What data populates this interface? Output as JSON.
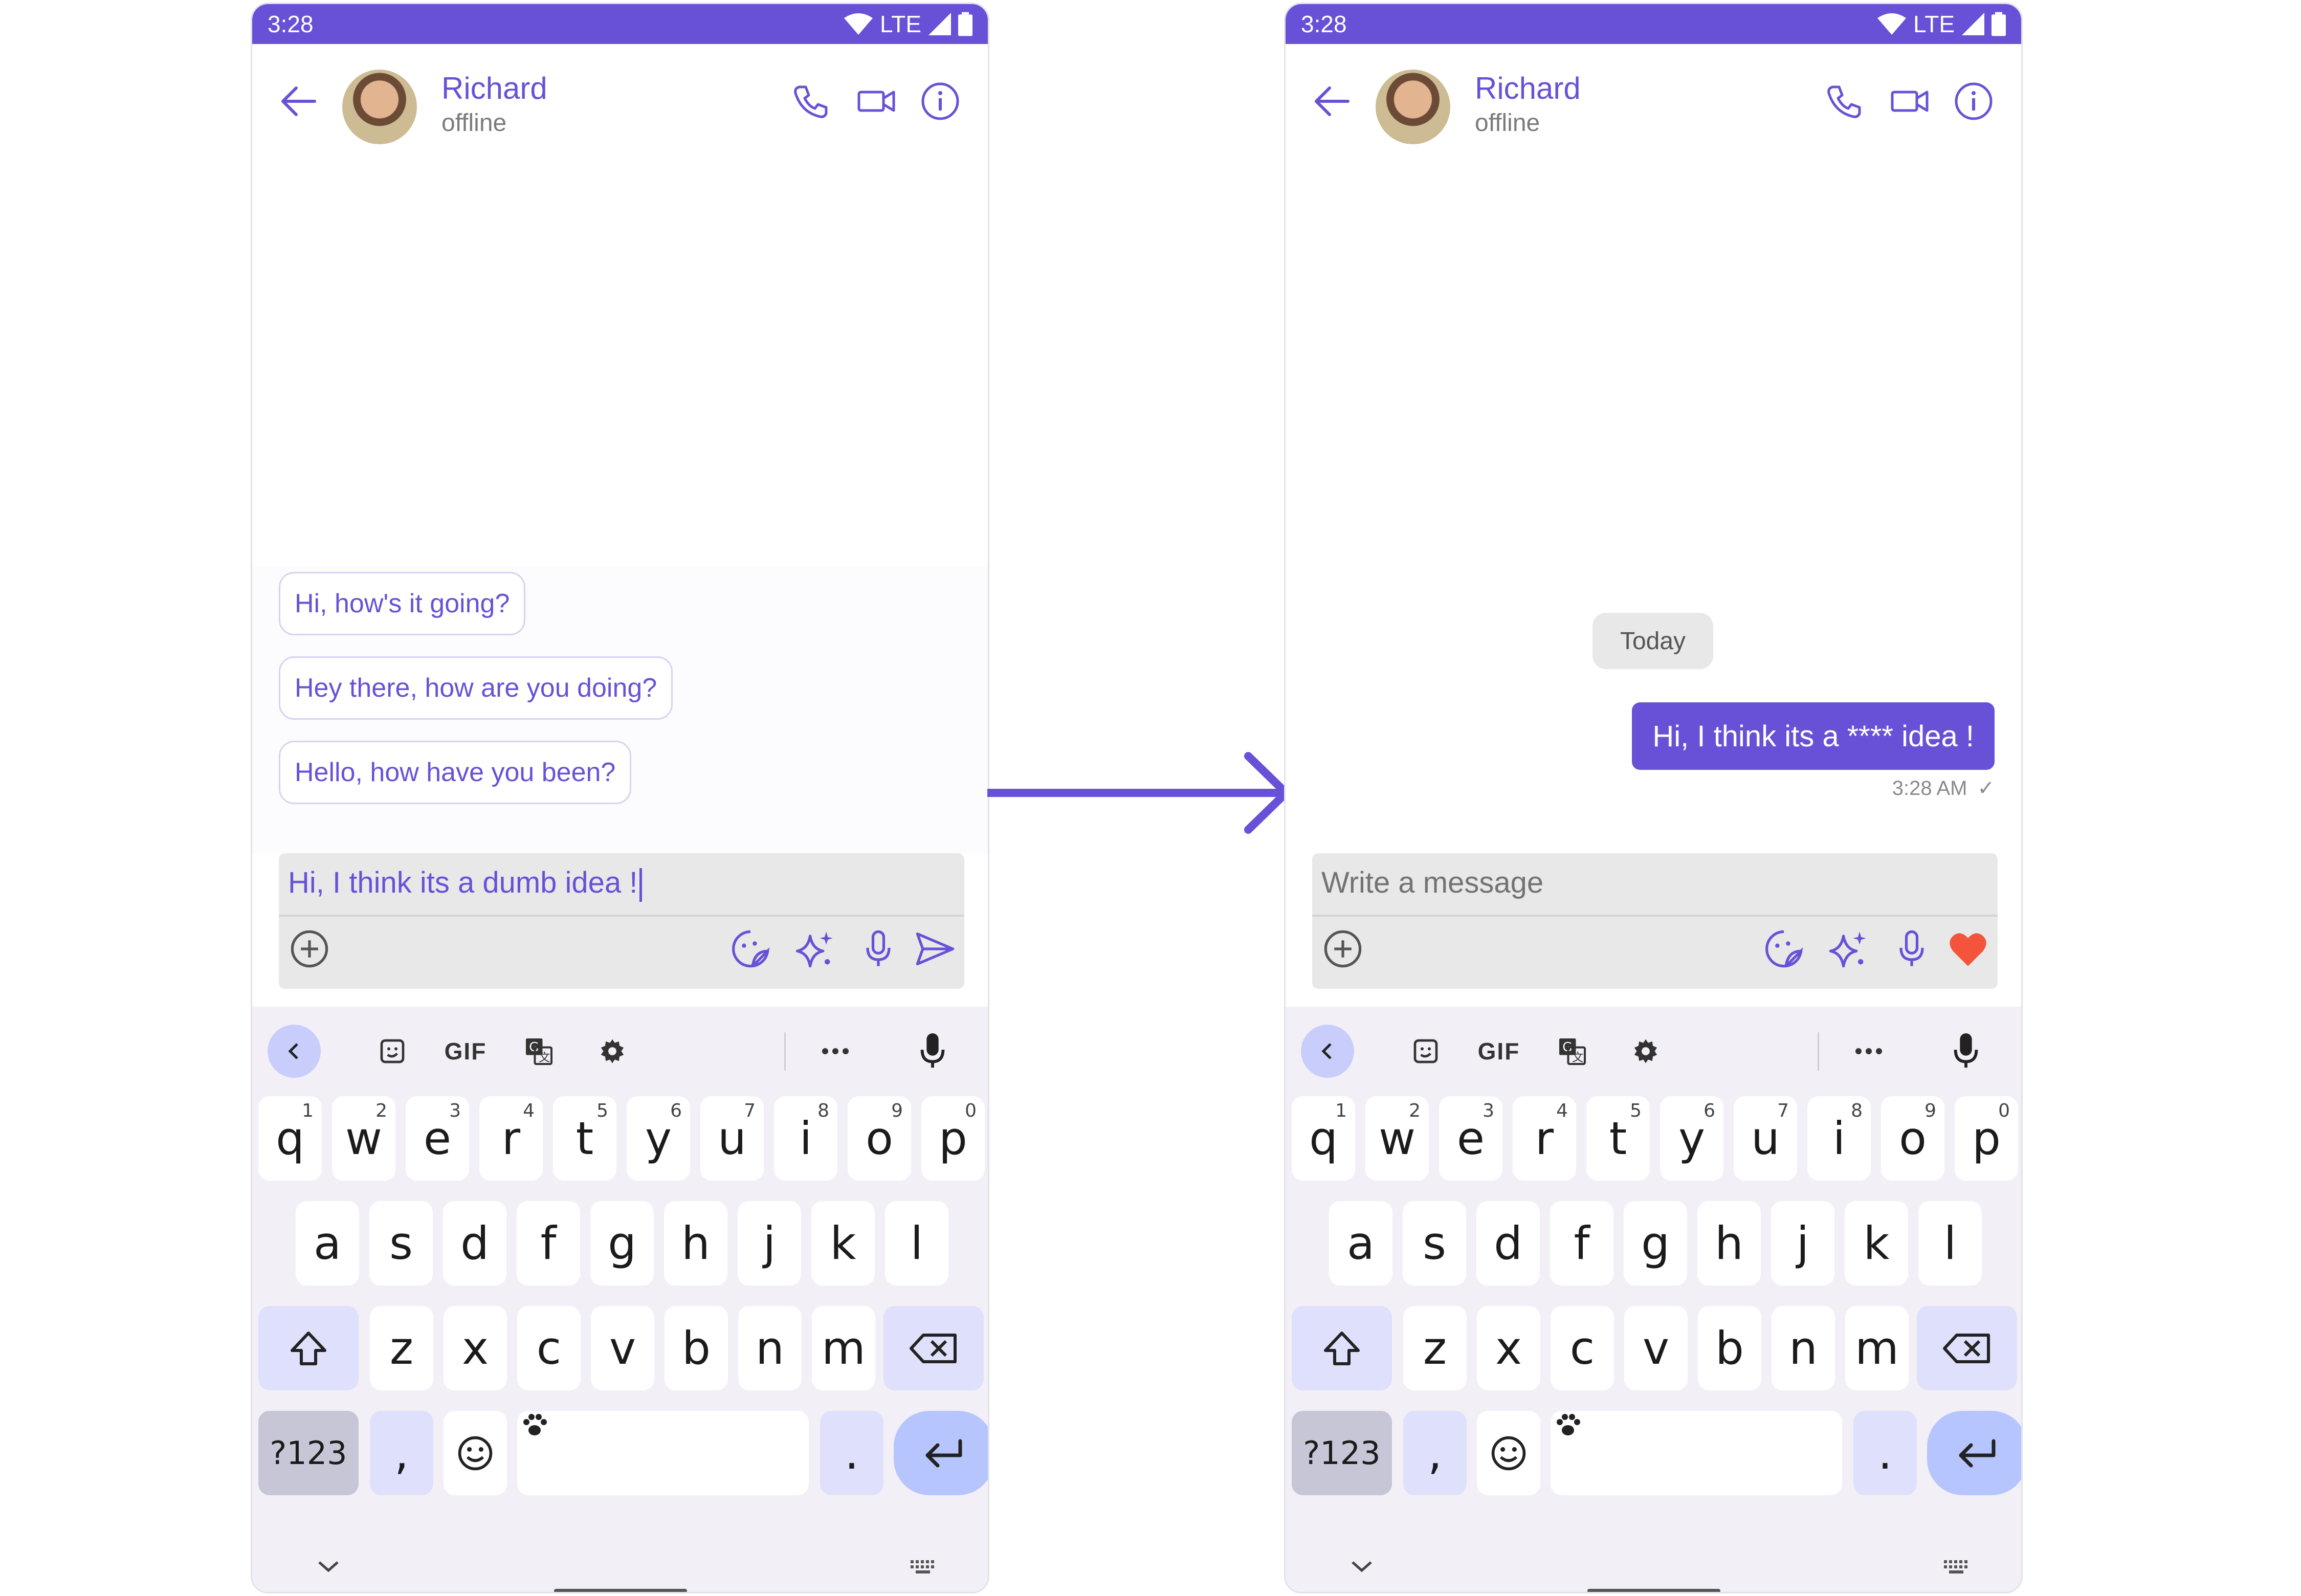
{
  "colors": {
    "accent": "#6851d6",
    "heart": "#f4543b",
    "chip_border": "#d8d2f3"
  },
  "phones": [
    {
      "status": {
        "time": "3:28",
        "network": "LTE"
      },
      "header": {
        "name": "Richard",
        "status": "offline"
      },
      "suggestions": [
        "Hi, how's it going?",
        "Hey there, how are you doing?",
        "Hello, how have you been?"
      ],
      "composer": {
        "text": "Hi, I think its a dumb idea !",
        "send_icon": "send-icon"
      }
    },
    {
      "status": {
        "time": "3:28",
        "network": "LTE"
      },
      "header": {
        "name": "Richard",
        "status": "offline"
      },
      "date_separator": "Today",
      "message": {
        "text": "Hi, I think its a **** idea !",
        "time": "3:28 AM",
        "receipt": "✓"
      },
      "composer": {
        "placeholder": "Write a message",
        "send_icon": "heart-icon"
      }
    }
  ],
  "keyboard": {
    "toolbar_gif": "GIF",
    "row1": [
      "q",
      "w",
      "e",
      "r",
      "t",
      "y",
      "u",
      "i",
      "o",
      "p"
    ],
    "row1_hints": [
      "1",
      "2",
      "3",
      "4",
      "5",
      "6",
      "7",
      "8",
      "9",
      "0"
    ],
    "row2": [
      "a",
      "s",
      "d",
      "f",
      "g",
      "h",
      "j",
      "k",
      "l"
    ],
    "row3": [
      "z",
      "x",
      "c",
      "v",
      "b",
      "n",
      "m"
    ],
    "symbols_key": "?123",
    "comma": ",",
    "period": "."
  }
}
